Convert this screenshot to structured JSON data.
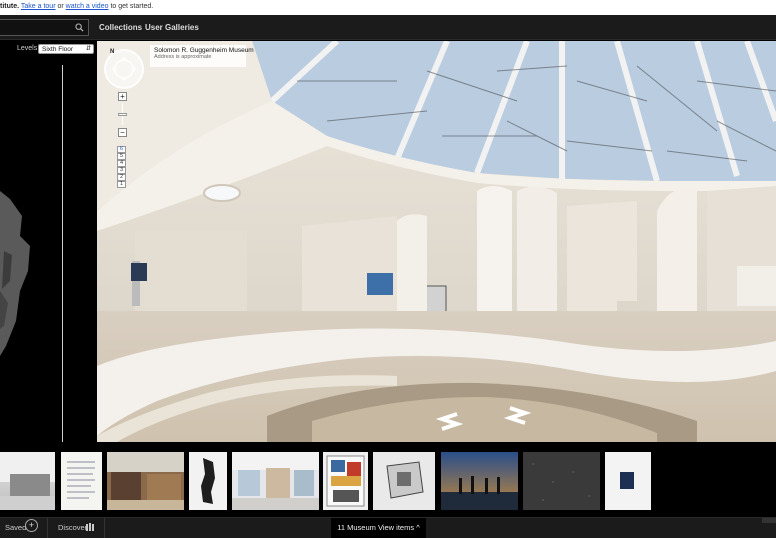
{
  "notice": {
    "lead": "titute.",
    "tour_link": "Take a tour",
    "or": "or",
    "video_link": "watch a video",
    "tail": "to get started."
  },
  "header": {
    "search_value": "",
    "nav": [
      "Collections",
      "User Galleries"
    ]
  },
  "floorplan": {
    "levels_label": "Levels",
    "level_selected": "Sixth Floor"
  },
  "streetview": {
    "place_title": "Solomon R. Guggenheim Museum",
    "place_subtitle": "Address is approximate",
    "compass_letter": "N",
    "zoom_in": "+",
    "zoom_out": "−",
    "floors": [
      "6",
      "5",
      "4",
      "3",
      "2",
      "1"
    ],
    "active_floor": "6"
  },
  "bottom": {
    "saved_label": "Saved",
    "saved_icon": "+",
    "discover_label": "Discover",
    "museum_view_label": "11 Museum View items",
    "museum_view_chevron": "^"
  },
  "colors": {
    "link": "#1a56c9",
    "header_bg": "#1b1b1b",
    "sky": "#b9cce0"
  }
}
